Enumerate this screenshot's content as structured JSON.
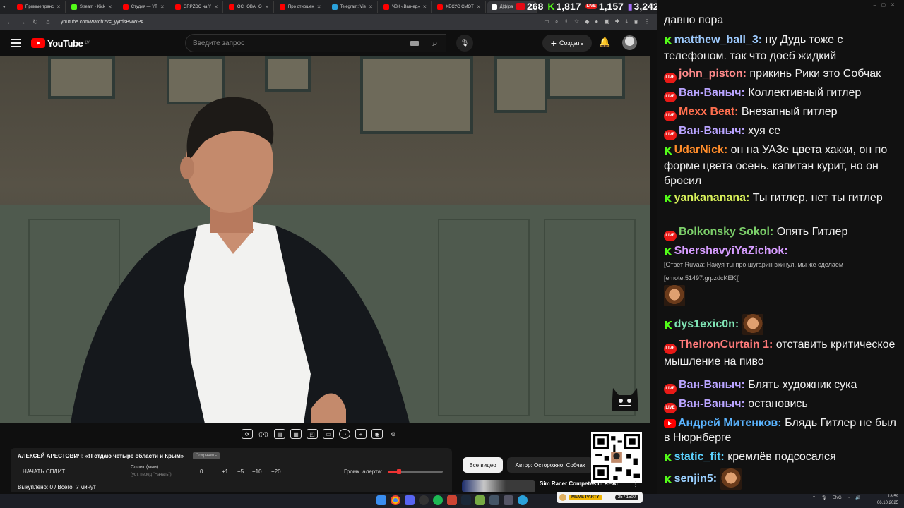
{
  "browser": {
    "tabs": [
      {
        "label": "Прямые транс",
        "color": "#ff0000"
      },
      {
        "label": "Stream - Kick",
        "color": "#53fc18"
      },
      {
        "label": "Студия — YT",
        "color": "#ff0000"
      },
      {
        "label": "GRPZDC на Y",
        "color": "#ff0000"
      },
      {
        "label": "ОСНОВАНО",
        "color": "#ff0000"
      },
      {
        "label": "Про отношен",
        "color": "#ff0000"
      },
      {
        "label": "Telegram: Vie",
        "color": "#2aa1da"
      },
      {
        "label": "ЧВК «Вагнер»",
        "color": "#ff0000"
      },
      {
        "label": "ХЕСУС СМОТ",
        "color": "#ff0000"
      },
      {
        "label": "Д|ф|ра",
        "color": "#ffffff"
      }
    ],
    "url": "youtube.com/watch?v=_yyrdsBwWPA"
  },
  "counters": [
    {
      "platform": "youtube",
      "value": "268"
    },
    {
      "platform": "kick",
      "value": "1,817"
    },
    {
      "platform": "vk-live",
      "value": "1,157"
    },
    {
      "platform": "twitch",
      "value": "3,242"
    }
  ],
  "youtube": {
    "logo_text": "YouTube",
    "region": "LV",
    "search_placeholder": "Введите запрос",
    "create_label": "Создать"
  },
  "player_tools": [
    "loop",
    "audio",
    "mini",
    "clip",
    "frame",
    "ambient",
    "speed",
    "add",
    "screenshot",
    "settings"
  ],
  "split": {
    "title": "АЛЕКСЕЙ АРЕСТОВИЧ: «Я отдаю четыре области и Крым»",
    "badge": "Сохранить",
    "start_label": "НАЧАТЬ СПЛИТ",
    "split_label": "Сплит (мин):",
    "split_hint": "(уст. перед \"Начать\")",
    "values": [
      "0",
      "+1",
      "+5",
      "+10",
      "+20"
    ],
    "volume_label": "Громк. алерта:",
    "volume_level": 0.2,
    "bought": "Выкуплено: 0 / Всего: ? минут"
  },
  "filters": {
    "all_videos": "Все видео",
    "author": "Автор: Осторожно: Собчак"
  },
  "recommended": {
    "title": "Sim Racer Competes In REAL"
  },
  "chat": {
    "messages": [
      {
        "platform": "none",
        "user": "",
        "user_color": "#ffffff",
        "text": "давно пора"
      },
      {
        "platform": "kick",
        "user": "matthew_ball_3:",
        "user_color": "#9ecbff",
        "text": " ну Дудь тоже с телефоном. так что доеб жидкий"
      },
      {
        "platform": "vk",
        "user": "john_piston:",
        "user_color": "#ff8a8a",
        "text": " прикинь Рики это Собчак"
      },
      {
        "platform": "vk",
        "user": "Ван-Ваныч:",
        "user_color": "#b9a4ff",
        "text": " Коллективный гитлер"
      },
      {
        "platform": "vk",
        "user": "Mexx Beat:",
        "user_color": "#ff6f4f",
        "text": " Внезапный гитлер"
      },
      {
        "platform": "vk",
        "user": "Ван-Ваныч:",
        "user_color": "#b9a4ff",
        "text": " хуя се"
      },
      {
        "platform": "kick",
        "user": "UdarNick:",
        "user_color": "#ff8c2a",
        "text": " он на УАЗе цвета хакки, он по форме цвета осень. капитан курит, но он бросил"
      },
      {
        "platform": "kick",
        "user": "yankananana:",
        "user_color": "#d8f05a",
        "text": " Ты гитлер, нет ты гитлер"
      },
      {
        "platform": "vk",
        "user": "Bolkonsky Sokol:",
        "user_color": "#7ccf6a",
        "text": " Опять Гитлер"
      },
      {
        "platform": "kick",
        "user": "ShershavyiYaZichok:",
        "user_color": "#d69cff",
        "text": ""
      },
      {
        "platform": "none",
        "user": "",
        "user_color": "#bbbbbb",
        "text": "[Ответ Ruvaa: Нахуя ты про шугарин вкинул, мы же сделаем"
      },
      {
        "platform": "none",
        "user": "",
        "user_color": "#bbbbbb",
        "text": "[emote:51497:grpzdcKEK]]"
      },
      {
        "platform": "kick",
        "user": "dys1exic0n:",
        "user_color": "#7fe3b4",
        "text": ""
      },
      {
        "platform": "vk",
        "user": "TheIronCurtain 1:",
        "user_color": "#ff7a7a",
        "text": " отставить критическое мышление на пиво"
      },
      {
        "platform": "vk",
        "user": "Ван-Ваныч:",
        "user_color": "#b9a4ff",
        "text": " Блять художник сука"
      },
      {
        "platform": "vk",
        "user": "Ван-Ваныч:",
        "user_color": "#b9a4ff",
        "text": " остановись"
      },
      {
        "platform": "youtube",
        "user": "Андрей Митенков:",
        "user_color": "#5ab4ff",
        "text": " Блядь Гитлер не был в Нюрнберге"
      },
      {
        "platform": "kick",
        "user": "static_fit:",
        "user_color": "#5bd2ff",
        "text": " кремлёв подсосался"
      },
      {
        "platform": "kick",
        "user": "senjin5:",
        "user_color": "#9ad0ff",
        "text": ""
      }
    ]
  },
  "taskbar": {
    "meme_tag": "МЕМЕ PARTY",
    "meme_count": "25 / 1500",
    "lang": "ENG",
    "time": "18:59",
    "date": "06.10.2025"
  }
}
